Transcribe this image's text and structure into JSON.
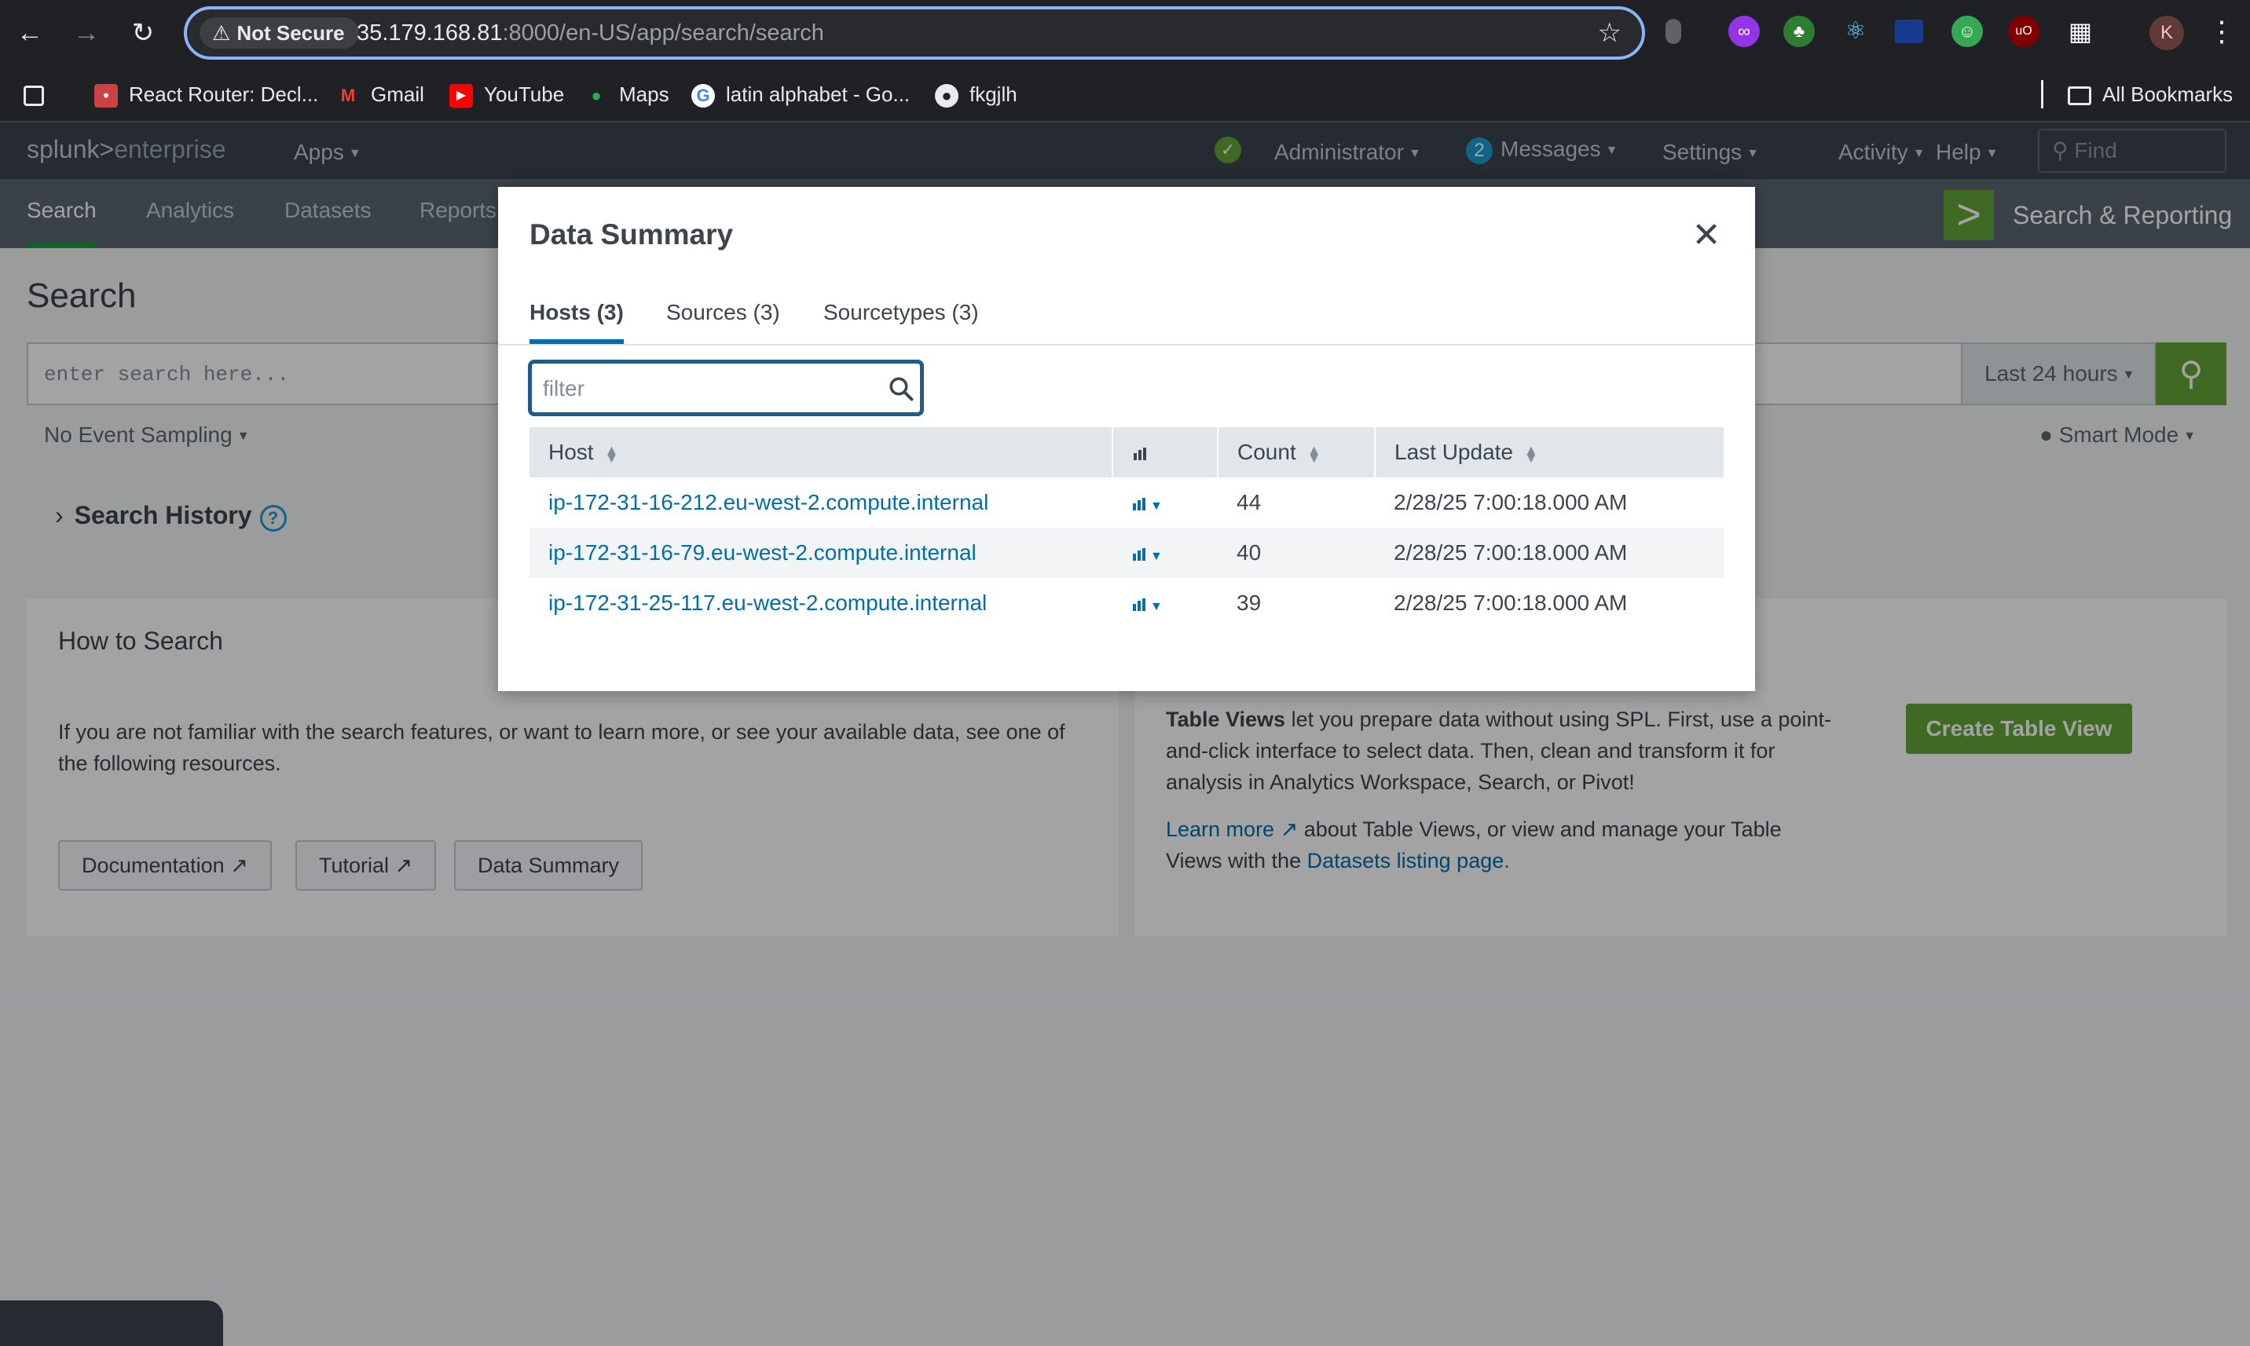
{
  "browser": {
    "security_label": "Not Secure",
    "url_host": "35.179.168.81",
    "url_path": ":8000/en-US/app/search/search",
    "profile_initial": "K",
    "bookmarks": [
      {
        "label": "React Router: Decl..."
      },
      {
        "label": "Gmail"
      },
      {
        "label": "YouTube"
      },
      {
        "label": "Maps"
      },
      {
        "label": "latin alphabet - Go..."
      },
      {
        "label": "fkgjlh"
      }
    ],
    "all_bookmarks_label": "All Bookmarks"
  },
  "app_bar": {
    "logo_left": "splunk>",
    "logo_right": "enterprise",
    "apps": "Apps",
    "status_icon": "check",
    "user": "Administrator",
    "messages_count": "2",
    "messages": "Messages",
    "settings": "Settings",
    "activity": "Activity",
    "help": "Help",
    "find_placeholder": "Find"
  },
  "app_nav": {
    "tabs": [
      "Search",
      "Analytics",
      "Datasets",
      "Reports"
    ],
    "app_title": "Search & Reporting"
  },
  "search_page": {
    "title": "Search",
    "search_placeholder": "enter search here...",
    "time_range": "Last 24 hours",
    "sampling": "No Event Sampling",
    "mode": "Smart Mode",
    "history": "Search History",
    "how_to_heading": "How to Search",
    "how_to_text_1": "If you are not familiar with the search features, or want to learn more, or see your available data, see one of",
    "how_to_text_2": "the following resources.",
    "buttons": [
      "Documentation",
      "Tutorial",
      "Data Summary"
    ],
    "table_views_bold": "Table Views",
    "table_views_text_1": " let you prepare data without using SPL. First, use a point-",
    "table_views_text_2": "and-click interface to select data. Then, clean and transform it for",
    "table_views_text_3": "analysis in Analytics Workspace, Search, or Pivot!",
    "learn_more": "Learn more",
    "learn_more_text": " about Table Views, or view and manage your Table",
    "views_with_the": "Views with the ",
    "datasets_link": "Datasets listing page.",
    "create_button": "Create Table View"
  },
  "modal": {
    "title": "Data Summary",
    "tabs": [
      "Hosts (3)",
      "Sources (3)",
      "Sourcetypes (3)"
    ],
    "filter_placeholder": "filter",
    "columns": {
      "host": "Host",
      "count": "Count",
      "last_update": "Last Update"
    },
    "rows": [
      {
        "host": "ip-172-31-16-212.eu-west-2.compute.internal",
        "count": "44",
        "last_update": "2/28/25 7:00:18.000 AM"
      },
      {
        "host": "ip-172-31-16-79.eu-west-2.compute.internal",
        "count": "40",
        "last_update": "2/28/25 7:00:18.000 AM"
      },
      {
        "host": "ip-172-31-25-117.eu-west-2.compute.internal",
        "count": "39",
        "last_update": "2/28/25 7:00:18.000 AM"
      }
    ]
  },
  "colors": {
    "accent_blue": "#006eaa",
    "splunk_green": "#65a637",
    "nav_dark": "#3c444d"
  }
}
